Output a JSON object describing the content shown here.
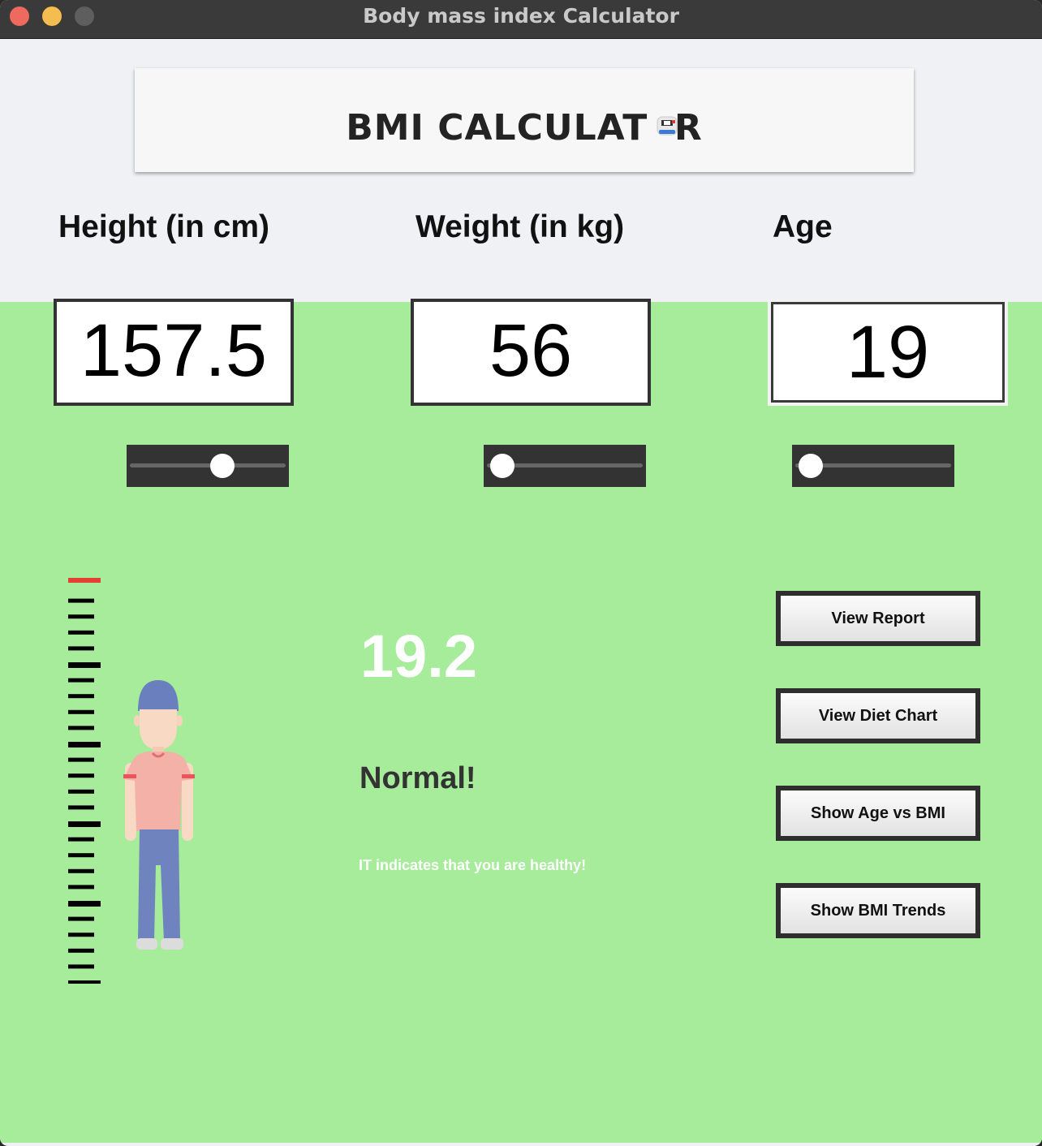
{
  "window": {
    "title": "Body mass index Calculator"
  },
  "header": {
    "title": "BMI CALCULAT  R"
  },
  "inputs": {
    "height": {
      "label": "Height (in cm)",
      "value": "157.5",
      "slider_fraction": 0.62
    },
    "weight": {
      "label": "Weight (in kg)",
      "value": "56",
      "slider_fraction": 0.0
    },
    "age": {
      "label": "Age",
      "value": "19",
      "slider_fraction": 0.0
    }
  },
  "result": {
    "bmi": "19.2",
    "status": "Normal!",
    "note": "IT indicates that you are healthy!"
  },
  "actions": {
    "view_report": "View Report",
    "view_diet_chart": "View Diet Chart",
    "show_age_vs_bmi": "Show Age vs BMI",
    "show_bmi_trends": "Show BMI Trends"
  },
  "colors": {
    "panel_green": "#a6ec9a",
    "ruler_top": "#e53e33",
    "slider_bg": "#333333"
  },
  "icons": [
    "scale-icon",
    "person-illustration",
    "height-ruler"
  ]
}
